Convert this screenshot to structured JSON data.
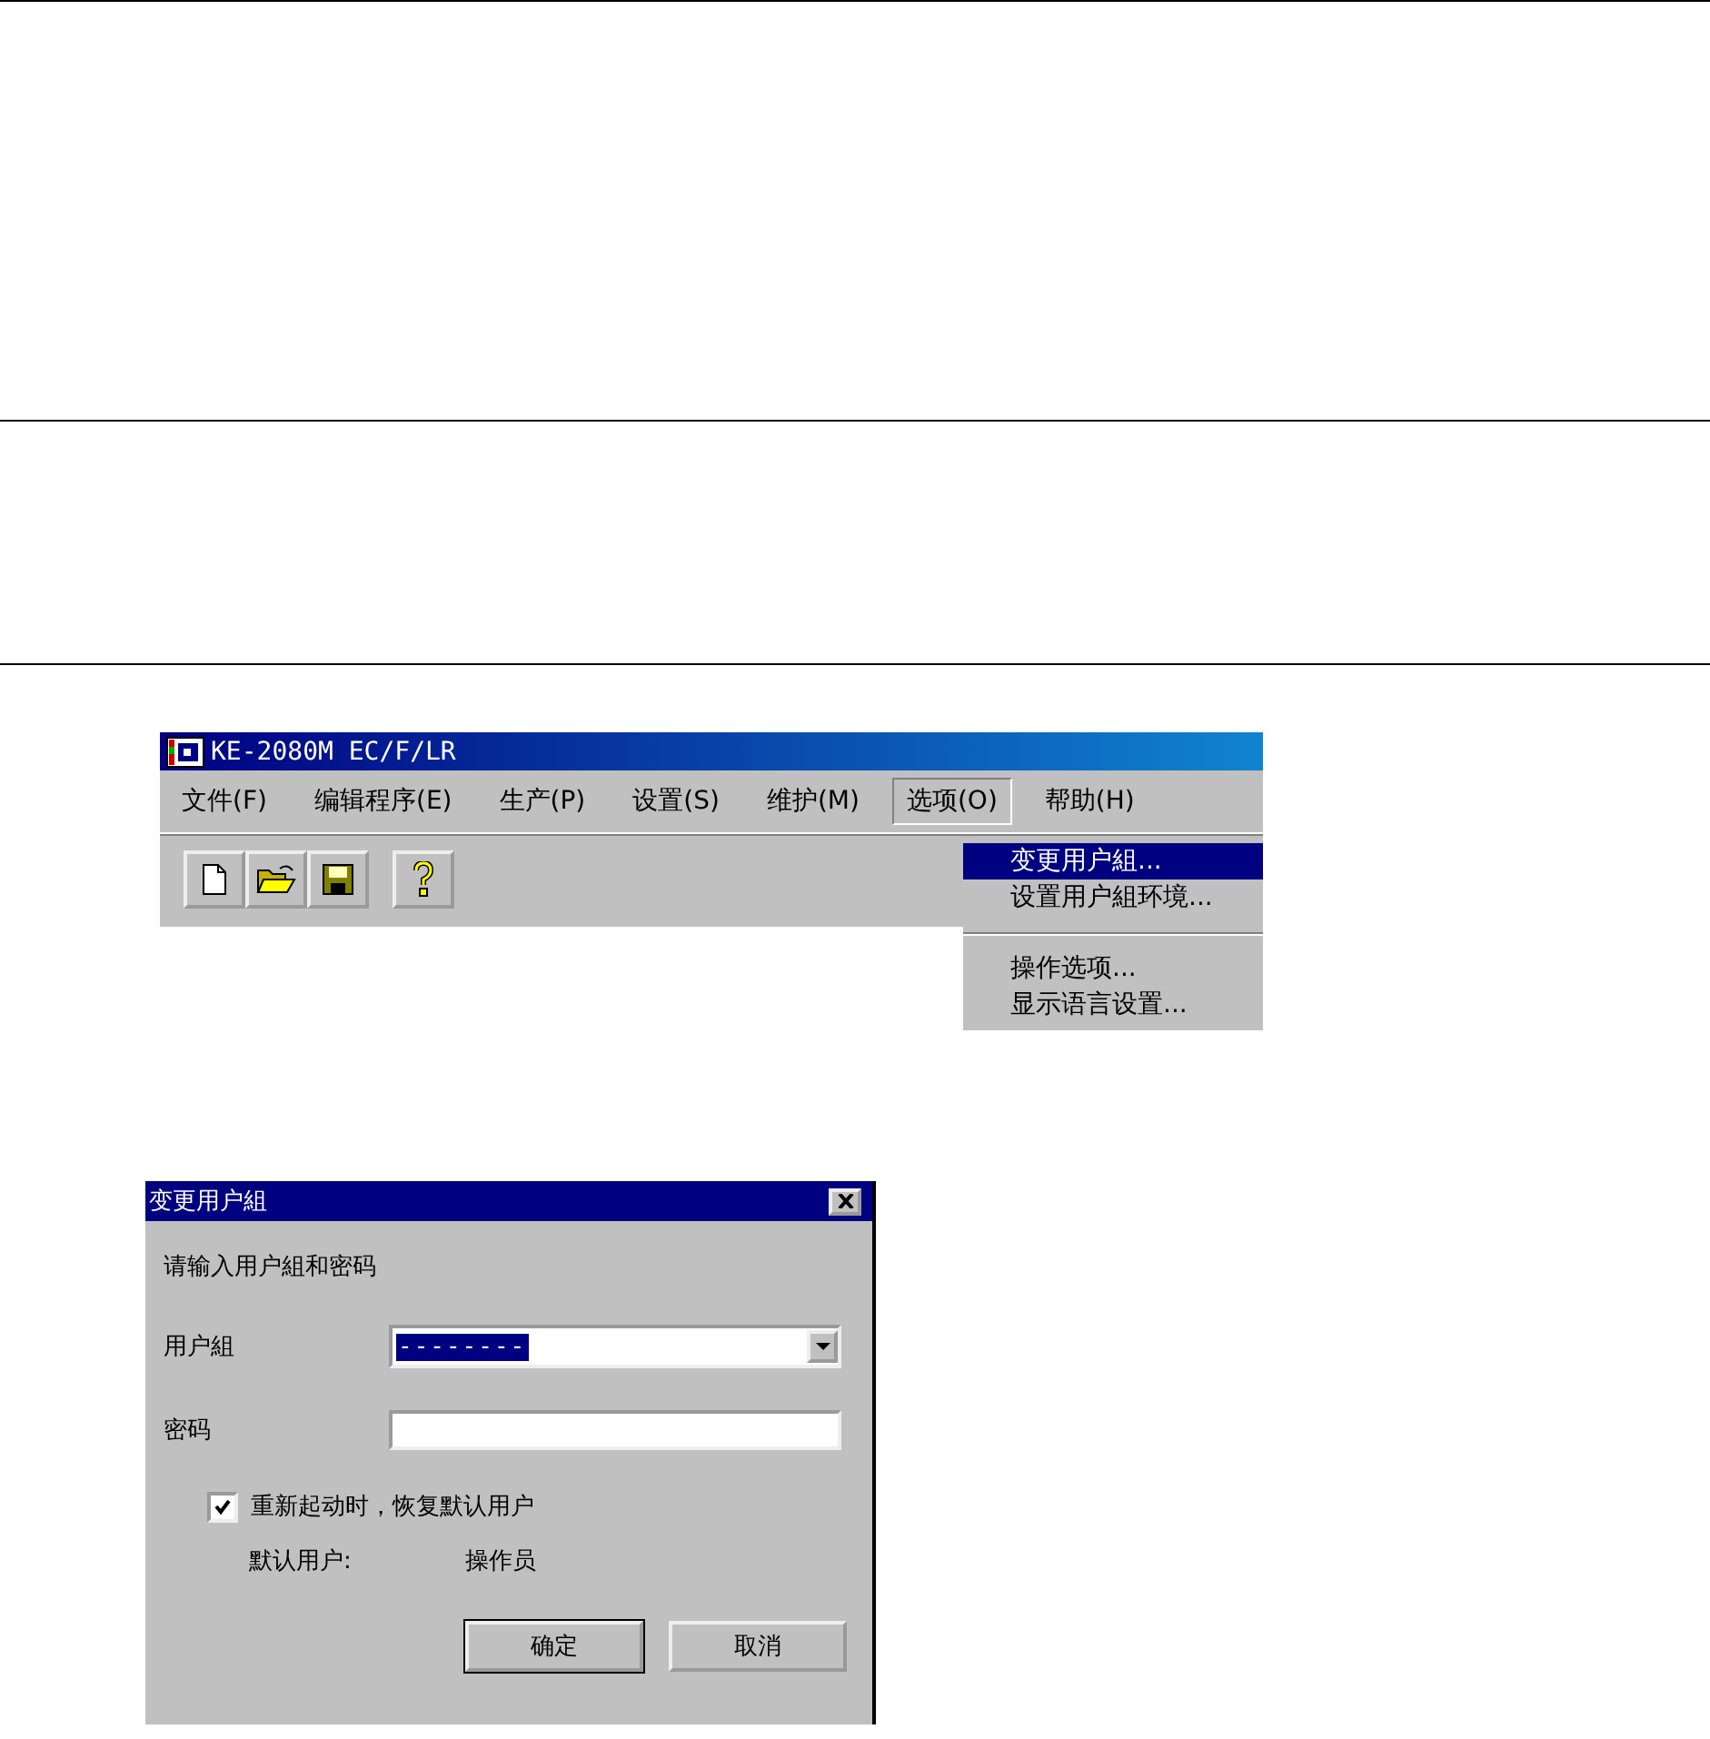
{
  "app_window": {
    "title": "KE-2080M EC/F/LR",
    "menu": [
      {
        "label": "文件(F)",
        "selected": false
      },
      {
        "label": "编辑程序(E)",
        "selected": false
      },
      {
        "label": "生产(P)",
        "selected": false
      },
      {
        "label": "设置(S)",
        "selected": false
      },
      {
        "label": "维护(M)",
        "selected": false
      },
      {
        "label": "选项(O)",
        "selected": true
      },
      {
        "label": "帮助(H)",
        "selected": false
      }
    ],
    "dropdown": [
      {
        "kind": "item",
        "label": "变更用户組...",
        "selected": true
      },
      {
        "kind": "item",
        "label": "设置用户組环境...",
        "selected": false
      },
      {
        "kind": "separator"
      },
      {
        "kind": "item",
        "label": "操作选项...",
        "selected": false
      },
      {
        "kind": "item",
        "label": "显示语言设置...",
        "selected": false
      }
    ]
  },
  "dialog": {
    "title": "变更用户組",
    "prompt": "请输入用户組和密码",
    "fields": [
      {
        "kind": "combo",
        "label": "用户組",
        "value": "--------",
        "highlighted": true
      },
      {
        "kind": "text",
        "label": "密码"
      }
    ],
    "checkbox": {
      "label": "重新起动时，恢复默认用户",
      "checked": true
    },
    "default_user": {
      "label": "默认用户:",
      "value": "操作员"
    },
    "buttons": [
      "确定",
      "取消"
    ]
  }
}
